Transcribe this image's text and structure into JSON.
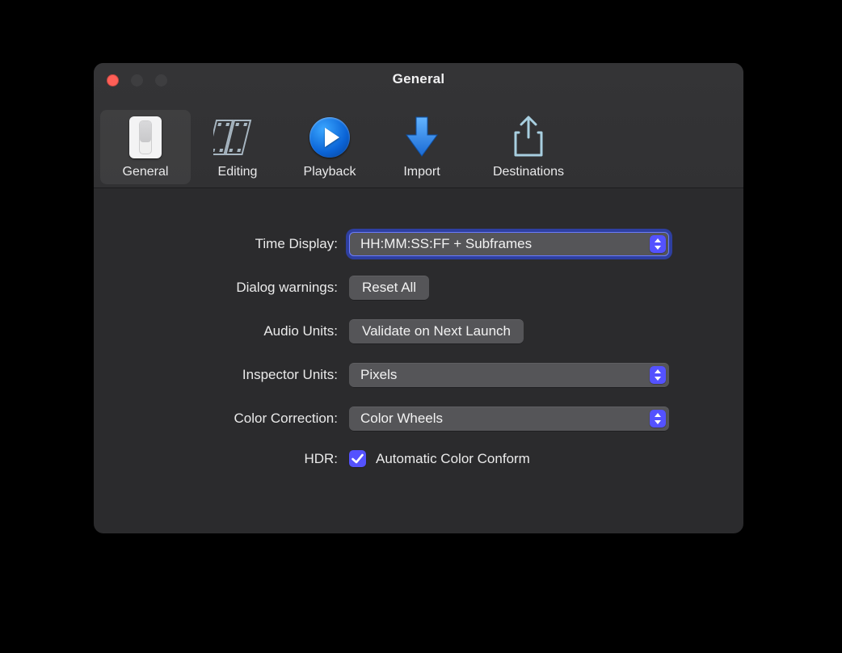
{
  "window": {
    "title": "General"
  },
  "toolbar": {
    "items": [
      {
        "label": "General"
      },
      {
        "label": "Editing"
      },
      {
        "label": "Playback"
      },
      {
        "label": "Import"
      },
      {
        "label": "Destinations"
      }
    ]
  },
  "form": {
    "time_display": {
      "label": "Time Display:",
      "value": "HH:MM:SS:FF + Subframes"
    },
    "dialog_warnings": {
      "label": "Dialog warnings:",
      "button": "Reset All"
    },
    "audio_units": {
      "label": "Audio Units:",
      "button": "Validate on Next Launch"
    },
    "inspector_units": {
      "label": "Inspector Units:",
      "value": "Pixels"
    },
    "color_correction": {
      "label": "Color Correction:",
      "value": "Color Wheels"
    },
    "hdr": {
      "label": "HDR:",
      "checkbox_label": "Automatic Color Conform",
      "checked": true
    }
  }
}
